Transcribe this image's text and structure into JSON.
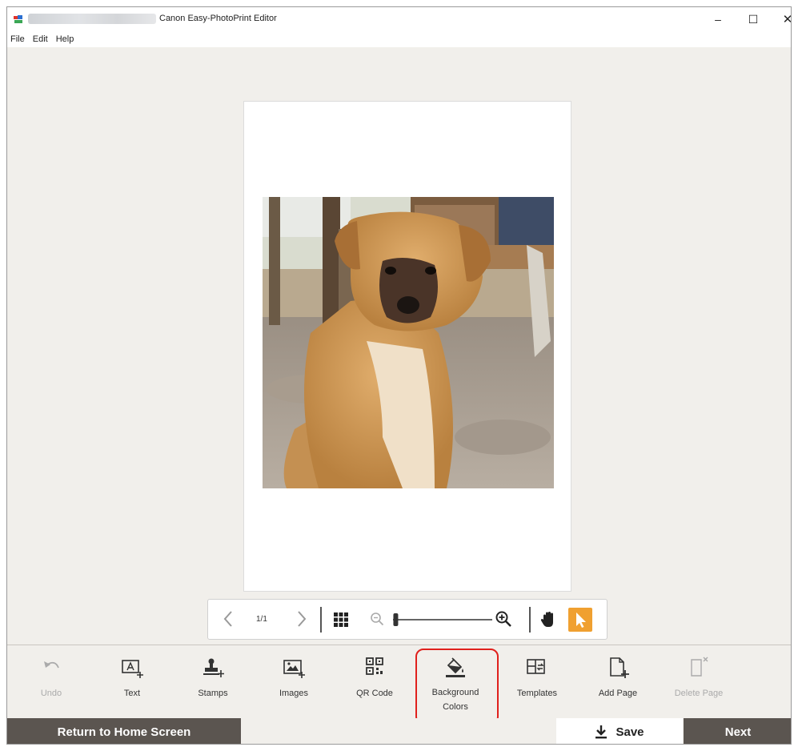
{
  "window": {
    "title": "Canon Easy-PhotoPrint Editor",
    "minimize_label": "–",
    "maximize_label": "☐",
    "close_label": "✕"
  },
  "menu": [
    "File",
    "Edit",
    "Help"
  ],
  "navigation": {
    "page_indicator": "1/1",
    "zoom_level": 0.02
  },
  "toolbar": {
    "items": [
      {
        "label": "Undo",
        "icon": "undo-icon",
        "enabled": false
      },
      {
        "label": "Text",
        "icon": "text-icon",
        "enabled": true
      },
      {
        "label": "Stamps",
        "icon": "stamp-icon",
        "enabled": true
      },
      {
        "label": "Images",
        "icon": "images-icon",
        "enabled": true
      },
      {
        "label": "QR Code",
        "icon": "qr-code-icon",
        "enabled": true
      },
      {
        "label": "Background",
        "label2": "Colors",
        "icon": "paint-bucket-icon",
        "enabled": true
      },
      {
        "label": "Templates",
        "icon": "templates-icon",
        "enabled": true
      },
      {
        "label": "Add Page",
        "icon": "add-page-icon",
        "enabled": true
      },
      {
        "label": "Delete Page",
        "icon": "delete-page-icon",
        "enabled": false
      }
    ]
  },
  "footer": {
    "home_label": "Return to Home Screen",
    "save_label": "Save",
    "next_label": "Next"
  },
  "colors": {
    "accent": "#f0a030",
    "highlight": "#e0201c",
    "footer_dark": "#5b5550",
    "background": "#f1efeb"
  }
}
